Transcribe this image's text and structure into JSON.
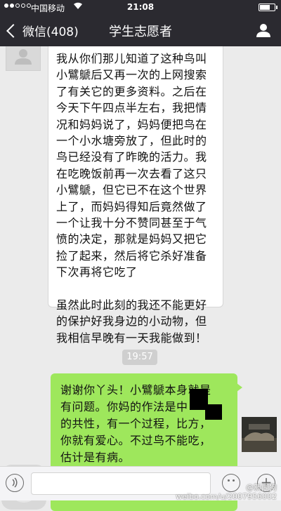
{
  "status_bar": {
    "carrier": "中国移动",
    "wifi_icon": "wifi-icon",
    "time": "21:08"
  },
  "nav": {
    "back_label": "微信(408)",
    "title": "学生志愿者",
    "profile_icon": "person-icon"
  },
  "messages": {
    "incoming": {
      "paragraph_1": "我从你们那儿知道了这种鸟叫小鷿鷈后又再一次的上网搜索了有关它的更多资料。之后在今天下午四点半左右，我把情况和妈妈说了，妈妈便把鸟在一个小水塘旁放了，但此时的鸟已经没有了昨晚的活力。我在吃晚饭前再一次去看了这只小鷿鷈，但它已不在这个世界上了，而妈妈得知后竟然做了一个让我十分不赞同甚至于气愤的决定，那就是妈妈又把它捡了起来，然后将它杀好准备下次再将它吃了",
      "paragraph_2": "虽然此时此刻的我还不能更好的保护好我身边的小动物，但我相信早晚有一天我能做到！"
    },
    "timestamp": "19:57",
    "outgoing": {
      "line_1": "谢谢你丫头！小鷿鷈本身就是",
      "line_2": "有问题。你妈的作法是中",
      "line_3": "的共性，有一个过程，比方，",
      "line_4": "你就有爱心。不过鸟不能吃，",
      "line_5": "估计是有病。"
    }
  },
  "input_bar": {
    "voice_icon": "voice-icon",
    "emoji_icon": "emoji-icon",
    "plus_icon": "plus-icon",
    "text_value": ""
  },
  "watermark": {
    "handle": "@新闻狗",
    "url": "weibo.com/u/2007956002"
  },
  "colors": {
    "nav_bg": "#2b2a30",
    "chat_bg": "#ebebeb",
    "outgoing_bubble": "#9ee75c",
    "incoming_bubble": "#ffffff"
  }
}
